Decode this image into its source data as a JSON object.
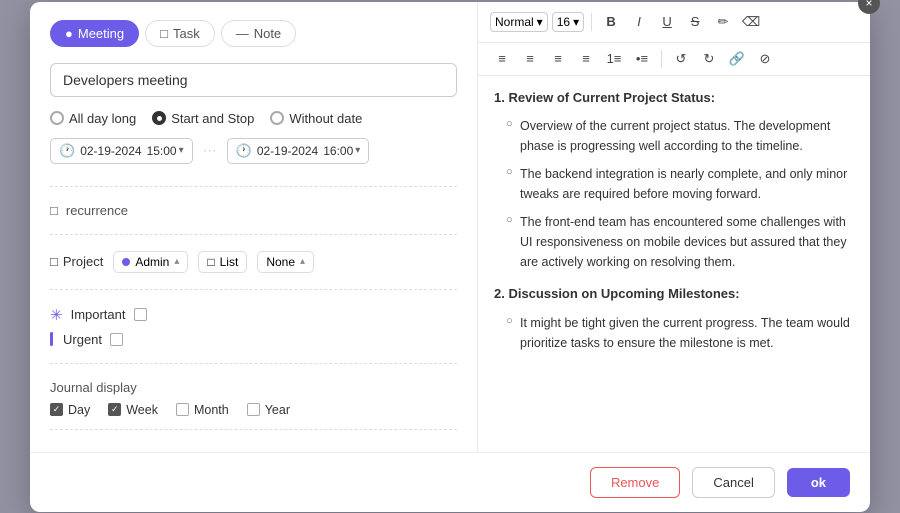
{
  "modal": {
    "close_label": "×"
  },
  "tabs": [
    {
      "id": "meeting",
      "label": "Meeting",
      "icon": "●",
      "active": true
    },
    {
      "id": "task",
      "label": "Task",
      "icon": "□",
      "active": false
    },
    {
      "id": "note",
      "label": "Note",
      "icon": "—",
      "active": false
    }
  ],
  "form": {
    "title_placeholder": "Developers meeting",
    "title_value": "Developers meeting",
    "date_options": [
      {
        "id": "all-day",
        "label": "All day long",
        "selected": false
      },
      {
        "id": "start-stop",
        "label": "Start and Stop",
        "selected": true
      },
      {
        "id": "no-date",
        "label": "Without date",
        "selected": false
      }
    ],
    "start_date": "02-19-2024",
    "start_time": "15:00",
    "end_date": "02-19-2024",
    "end_time": "16:00",
    "recurrence_label": "recurrence",
    "project_label": "Project",
    "project_value": "Admin",
    "list_label": "List",
    "list_value": "None",
    "flags": [
      {
        "id": "important",
        "label": "Important",
        "icon": "✳",
        "checked": false
      },
      {
        "id": "urgent",
        "label": "Urgent",
        "icon": "bar",
        "checked": false
      }
    ],
    "journal_label": "Journal display",
    "journal_options": [
      {
        "id": "day",
        "label": "Day",
        "checked": true
      },
      {
        "id": "week",
        "label": "Week",
        "checked": true
      },
      {
        "id": "month",
        "label": "Month",
        "checked": false
      },
      {
        "id": "year",
        "label": "Year",
        "checked": false
      }
    ]
  },
  "editor": {
    "toolbar": {
      "style_label": "Normal",
      "size_label": "16",
      "buttons": [
        "B",
        "I",
        "U",
        "S",
        "✏",
        "⌫"
      ]
    },
    "content": {
      "section1_heading": "1. Review of Current Project Status:",
      "section1_items": [
        "Overview of the current project status. The development phase is progressing well according to the timeline.",
        "The backend integration is nearly complete, and only minor tweaks are required before moving forward.",
        "The front-end team has encountered some challenges with UI responsiveness on mobile devices but assured that they are actively working on resolving them."
      ],
      "section2_heading": "2. Discussion on Upcoming Milestones:",
      "section2_items": [
        "It might be tight given the current progress. The team would prioritize tasks to ensure the milestone is met."
      ]
    }
  },
  "footer": {
    "remove_label": "Remove",
    "cancel_label": "Cancel",
    "ok_label": "ok"
  }
}
